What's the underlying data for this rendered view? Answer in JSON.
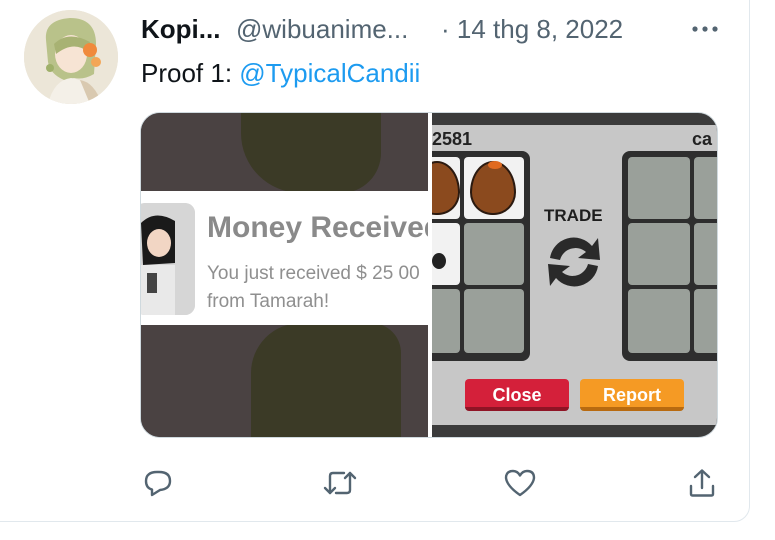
{
  "tweet": {
    "author_name": "Kopi...",
    "author_handle": "@wibuanime...",
    "date": "· 14 thg 8, 2022",
    "more_icon": "more-horizontal-icon",
    "text_prefix": "Proof 1: ",
    "mention": "@TypicalCandii"
  },
  "media": {
    "notification": {
      "title": "Money Received",
      "line1": "You just received $ 25 00",
      "line2": "from Tamarah!"
    },
    "trade_window": {
      "left_user": "2581",
      "right_user": "ca",
      "trade_label": "TRADE",
      "close_label": "Close",
      "report_label": "Report"
    }
  },
  "actions": [
    {
      "name": "reply",
      "icon": "reply-icon"
    },
    {
      "name": "retweet",
      "icon": "retweet-icon"
    },
    {
      "name": "like",
      "icon": "heart-icon"
    },
    {
      "name": "share",
      "icon": "share-icon"
    }
  ],
  "colors": {
    "link": "#1d9bf0",
    "secondary_text": "#536471",
    "close_button": "#d4203a",
    "report_button": "#f59a24"
  }
}
